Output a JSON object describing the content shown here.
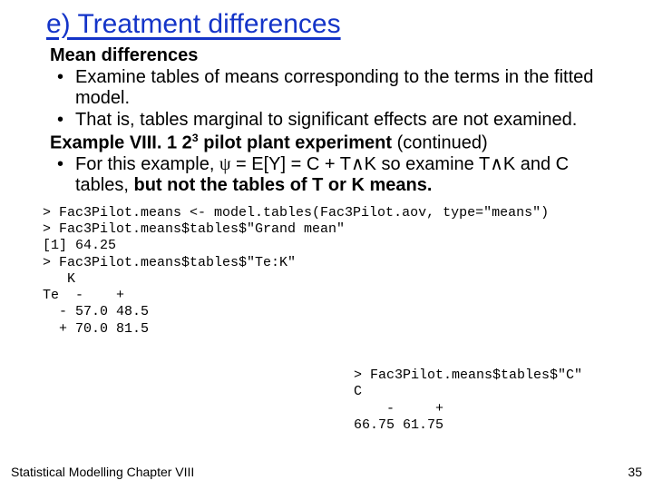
{
  "heading": "e)  Treatment differences",
  "subhead": "Mean differences",
  "bullets": [
    "Examine tables of means corresponding to the terms in the fitted model.",
    "That is, tables marginal to significant effects are not examined."
  ],
  "example": {
    "label_prefix": "Example VIII. 1 2",
    "label_sup": "3",
    "label_suffix": " pilot plant experiment",
    "label_cont": " (continued)"
  },
  "bullet3": {
    "a": "For this example, ",
    "psi": "ψ",
    "b": " = E[Y] = C +  T",
    "wedge1": "∧",
    "c": "K so examine T",
    "wedge2": "∧",
    "d": "K and C tables, ",
    "bold": "but not the tables of T or K means."
  },
  "code_left": "> Fac3Pilot.means <- model.tables(Fac3Pilot.aov, type=\"means\")\n> Fac3Pilot.means$tables$\"Grand mean\"\n[1] 64.25\n> Fac3Pilot.means$tables$\"Te:K\"\n   K\nTe  -    +\n  - 57.0 48.5\n  + 70.0 81.5",
  "code_right": "> Fac3Pilot.means$tables$\"C\"\nC\n    -     +\n66.75 61.75",
  "footer_left": "Statistical Modelling   Chapter VIII",
  "footer_right": "35"
}
